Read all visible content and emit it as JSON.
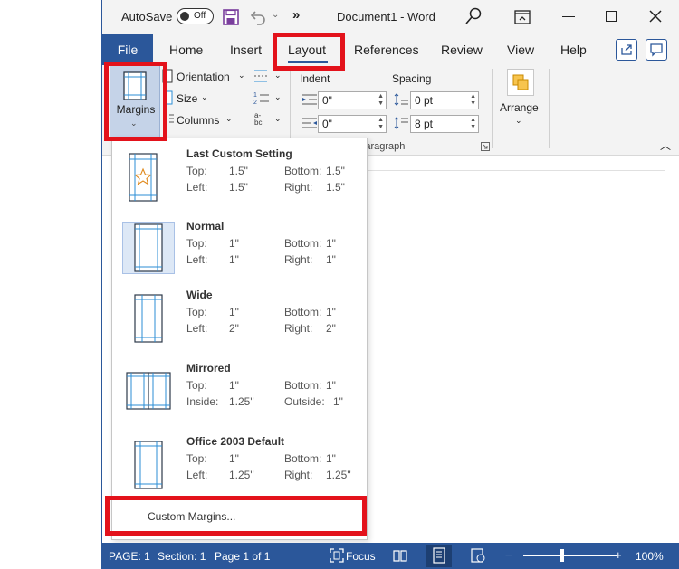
{
  "titlebar": {
    "autosave_label": "AutoSave",
    "autosave_state": "Off",
    "more_tools": "»",
    "document_title": "Document1 - Word"
  },
  "tabs": {
    "file": "File",
    "home": "Home",
    "insert": "Insert",
    "layout": "Layout",
    "references": "References",
    "review": "Review",
    "view": "View",
    "help": "Help"
  },
  "ribbon": {
    "margins_label": "Margins",
    "orientation": "Orientation",
    "size": "Size",
    "columns": "Columns",
    "indent_label": "Indent",
    "spacing_label": "Spacing",
    "indent_left": "0\"",
    "indent_right": "0\"",
    "spacing_before": "0 pt",
    "spacing_after": "8 pt",
    "paragraph_group": "Paragraph",
    "arrange": "Arrange"
  },
  "margins_menu": {
    "options": [
      {
        "name": "Last Custom Setting",
        "k1": "Top:",
        "v1": "1.5\"",
        "k2": "Bottom:",
        "v2": "1.5\"",
        "k3": "Left:",
        "v3": "1.5\"",
        "k4": "Right:",
        "v4": "1.5\""
      },
      {
        "name": "Normal",
        "k1": "Top:",
        "v1": "1\"",
        "k2": "Bottom:",
        "v2": "1\"",
        "k3": "Left:",
        "v3": "1\"",
        "k4": "Right:",
        "v4": "1\""
      },
      {
        "name": "Wide",
        "k1": "Top:",
        "v1": "1\"",
        "k2": "Bottom:",
        "v2": "1\"",
        "k3": "Left:",
        "v3": "2\"",
        "k4": "Right:",
        "v4": "2\""
      },
      {
        "name": "Mirrored",
        "k1": "Top:",
        "v1": "1\"",
        "k2": "Bottom:",
        "v2": "1\"",
        "k3": "Inside:",
        "v3": "1.25\"",
        "k4": "Outside:",
        "v4": "1\""
      },
      {
        "name": "Office 2003 Default",
        "k1": "Top:",
        "v1": "1\"",
        "k2": "Bottom:",
        "v2": "1\"",
        "k3": "Left:",
        "v3": "1.25\"",
        "k4": "Right:",
        "v4": "1.25\""
      }
    ],
    "custom_margins": "Custom Margins..."
  },
  "statusbar": {
    "page": "PAGE: 1",
    "section": "Section: 1",
    "page_of": "Page 1 of 1",
    "focus": "Focus",
    "zoom_minus": "−",
    "zoom_plus": "+",
    "zoom": "100%",
    "zoom_level_percent": 100
  },
  "colors": {
    "accent": "#2b579a",
    "callout": "#e3121b"
  }
}
